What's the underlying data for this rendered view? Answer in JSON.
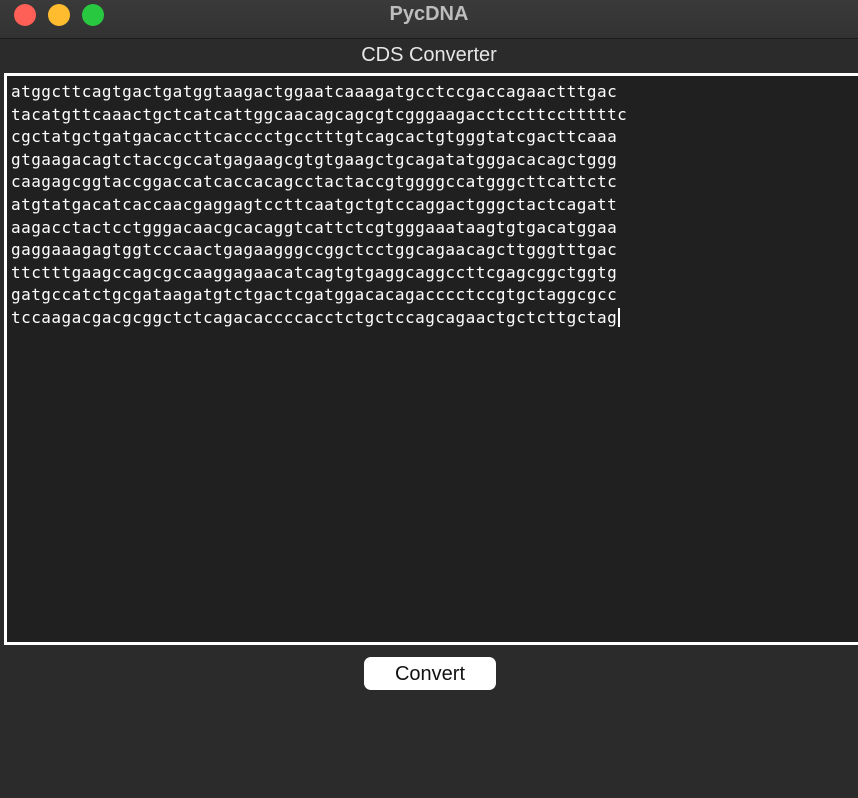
{
  "window": {
    "title": "PycDNA",
    "colors": {
      "close": "#fe5f57",
      "minimize": "#febc2e",
      "maximize": "#28c840"
    }
  },
  "header": {
    "title": "CDS Converter"
  },
  "sequence_input": {
    "lines": [
      "atggcttcagtgactgatggtaagactggaatcaaagatgcctccgaccagaactttgac",
      "tacatgttcaaactgctcatcattggcaacagcagcgtcgggaagacctccttcctttttc",
      "cgctatgctgatgacaccttcacccctgcctttgtcagcactgtgggtatcgacttcaaa",
      "gtgaagacagtctaccgccatgagaagcgtgtgaagctgcagatatgggacacagctggg",
      "caagagcggtaccggaccatcaccacagcctactaccgtggggccatgggcttcattctc",
      "atgtatgacatcaccaacgaggagtccttcaatgctgtccaggactgggctactcagatt",
      "aagacctactcctgggacaacgcacaggtcattctcgtgggaaataagtgtgacatggaa",
      "gaggaaagagtggtcccaactgagaagggccggctcctggcagaacagcttgggtttgac",
      "ttctttgaagccagcgccaaggagaacatcagtgtgaggcaggccttcgagcggctggtg",
      "gatgccatctgcgataagatgtctgactcgatggacacagacccctccgtgctaggcgcc",
      "tccaagacgacgcggctctcagacaccccacctctgctccagcagaactgctcttgctag"
    ]
  },
  "actions": {
    "convert_label": "Convert"
  }
}
